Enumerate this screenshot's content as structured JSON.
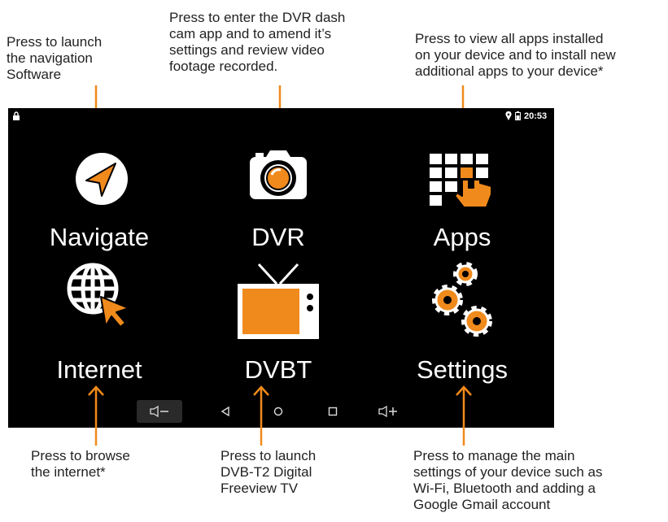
{
  "callouts": {
    "navigate": "Press to launch\nthe navigation\nSoftware",
    "dvr": "Press to enter the DVR dash\ncam app and to amend it’s\nsettings and review video\nfootage recorded.",
    "apps": "Press to view all apps installed\non your device and to install new\nadditional apps to your device*",
    "internet": "Press to browse\nthe internet*",
    "dvbt": "Press to launch\nDVB-T2 Digital\nFreeview TV",
    "settings": "Press to manage the main\nsettings of your device such as\nWi-Fi, Bluetooth and adding a\nGoogle Gmail account"
  },
  "status": {
    "time": "20:53"
  },
  "apps": [
    {
      "label": "Navigate",
      "icon": "navigation-arrow-icon"
    },
    {
      "label": "DVR",
      "icon": "camera-icon"
    },
    {
      "label": "Apps",
      "icon": "app-grid-hand-icon"
    },
    {
      "label": "Internet",
      "icon": "globe-cursor-icon"
    },
    {
      "label": "DVBT",
      "icon": "tv-icon"
    },
    {
      "label": "Settings",
      "icon": "gears-icon"
    }
  ],
  "colors": {
    "accent": "#f08a1c",
    "screen": "#000000",
    "text": "#222222"
  }
}
